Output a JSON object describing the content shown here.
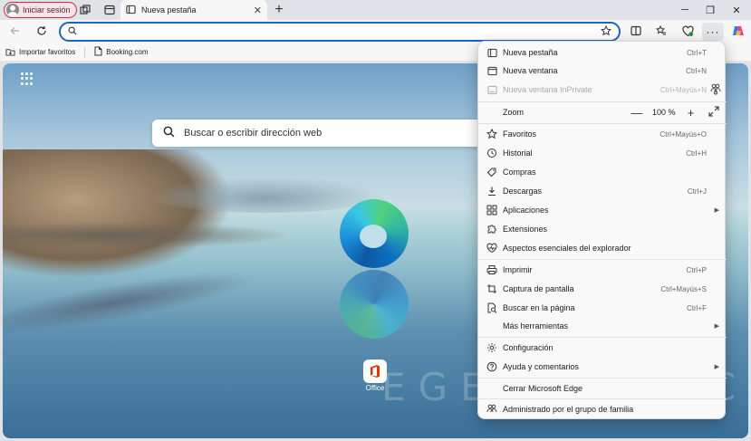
{
  "titlebar": {
    "profile_label": "Iniciar sesión",
    "tab_title": "Nueva pestaña",
    "tab_close": "✕",
    "new_tab": "+",
    "minimize": "─",
    "restore": "❐",
    "close": "✕"
  },
  "address_bar": {
    "value": "",
    "placeholder": ""
  },
  "favorites_bar": {
    "items": [
      {
        "label": "Importar favoritos",
        "icon": "import-icon"
      },
      {
        "label": "Booking.com",
        "icon": "page-icon"
      }
    ]
  },
  "ntp": {
    "search_placeholder": "Buscar o escribir dirección web",
    "office_label": "Office",
    "office_letter": "O",
    "watermark": "EGEEKNETIC"
  },
  "menu": {
    "items": [
      {
        "label": "Nueva pestaña",
        "shortcut": "Ctrl+T",
        "icon": "new-tab-icon"
      },
      {
        "label": "Nueva ventana",
        "shortcut": "Ctrl+N",
        "icon": "new-window-icon"
      },
      {
        "label": "Nueva ventana InPrivate",
        "shortcut": "Ctrl+Mayús+N",
        "icon": "inprivate-icon",
        "disabled": true
      },
      {
        "label": "Zoom",
        "zoom_value": "100 %",
        "zoom_minus": "—",
        "zoom_plus": "+"
      },
      {
        "label": "Favoritos",
        "shortcut": "Ctrl+Mayús+O",
        "icon": "star-icon"
      },
      {
        "label": "Historial",
        "shortcut": "Ctrl+H",
        "icon": "history-icon"
      },
      {
        "label": "Compras",
        "shortcut": "",
        "icon": "tag-icon"
      },
      {
        "label": "Descargas",
        "shortcut": "Ctrl+J",
        "icon": "download-icon"
      },
      {
        "label": "Aplicaciones",
        "submenu": true,
        "icon": "apps-icon"
      },
      {
        "label": "Extensiones",
        "shortcut": "",
        "icon": "puzzle-icon"
      },
      {
        "label": "Aspectos esenciales del explorador",
        "shortcut": "",
        "icon": "heart-pulse-icon"
      },
      {
        "label": "Imprimir",
        "shortcut": "Ctrl+P",
        "icon": "printer-icon"
      },
      {
        "label": "Captura de pantalla",
        "shortcut": "Ctrl+Mayús+S",
        "icon": "screenshot-icon"
      },
      {
        "label": "Buscar en la página",
        "shortcut": "Ctrl+F",
        "icon": "find-icon"
      },
      {
        "label": "Más herramientas",
        "submenu": true,
        "icon": ""
      },
      {
        "label": "Configuración",
        "shortcut": "",
        "icon": "gear-icon"
      },
      {
        "label": "Ayuda y comentarios",
        "submenu": true,
        "icon": "help-icon"
      },
      {
        "label": "Cerrar Microsoft Edge",
        "shortcut": "",
        "icon": ""
      },
      {
        "label": "Administrado por el grupo de familia",
        "shortcut": "",
        "icon": "family-icon"
      }
    ],
    "submenu_arrow": "▶"
  },
  "colors": {
    "accent": "#1a64c8",
    "profile_border": "#c4314b",
    "menu_bg": "#f9f9f9"
  }
}
